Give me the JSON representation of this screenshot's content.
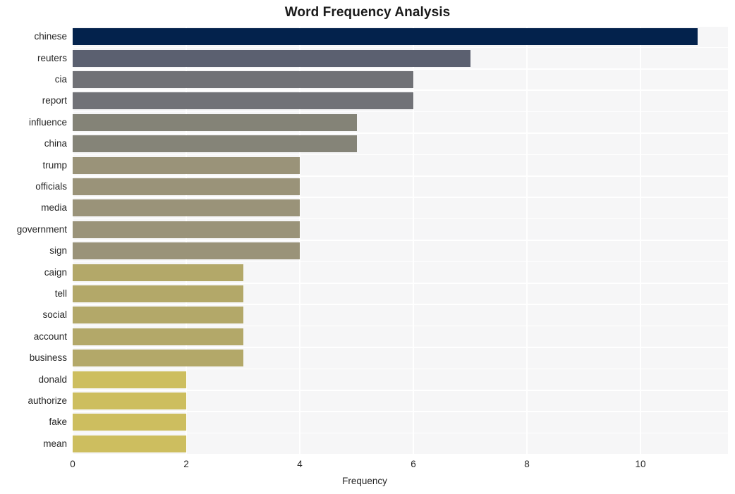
{
  "chart_data": {
    "type": "bar",
    "orientation": "horizontal",
    "title": "Word Frequency Analysis",
    "xlabel": "Frequency",
    "ylabel": "",
    "categories": [
      "chinese",
      "reuters",
      "cia",
      "report",
      "influence",
      "china",
      "trump",
      "officials",
      "media",
      "government",
      "sign",
      "caign",
      "tell",
      "social",
      "account",
      "business",
      "donald",
      "authorize",
      "fake",
      "mean"
    ],
    "values": [
      11,
      7,
      6,
      6,
      5,
      5,
      4,
      4,
      4,
      4,
      4,
      3,
      3,
      3,
      3,
      3,
      2,
      2,
      2,
      2
    ],
    "xlim": [
      0,
      11.54
    ],
    "xticks": [
      0,
      2,
      4,
      6,
      8,
      10
    ],
    "xtick_labels": [
      "0",
      "2",
      "4",
      "6",
      "8",
      "10"
    ],
    "grid": true,
    "grid_color": "#ffffff",
    "plot_background": "#f6f6f7",
    "figure_background": "#ffffff",
    "legend": null,
    "bar_colors": [
      "#03224c",
      "#5b6070",
      "#707176",
      "#717277",
      "#848377",
      "#858478",
      "#9a9379",
      "#9a9379",
      "#9a9379",
      "#9a9379",
      "#9a9379",
      "#b3a869",
      "#b3a869",
      "#b3a869",
      "#b3a869",
      "#b3a869",
      "#cdbe5f",
      "#cdbe5f",
      "#cdbe5f",
      "#cdbe5f"
    ]
  }
}
